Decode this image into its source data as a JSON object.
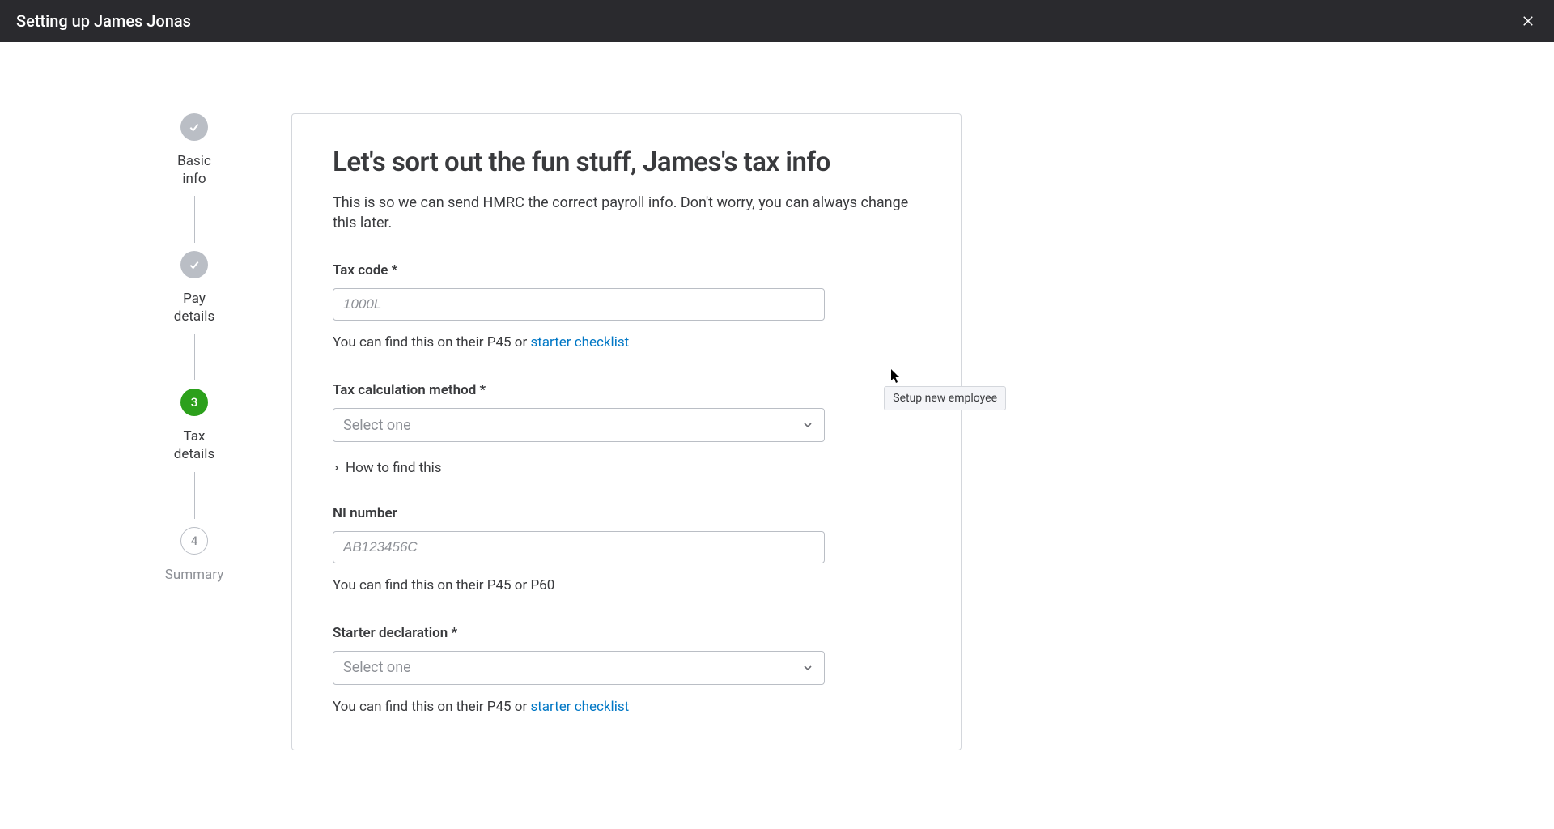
{
  "header": {
    "title": "Setting up James Jonas"
  },
  "stepper": {
    "steps": [
      {
        "label_line1": "Basic",
        "label_line2": "info",
        "state": "completed"
      },
      {
        "label_line1": "Pay",
        "label_line2": "details",
        "state": "completed"
      },
      {
        "number": "3",
        "label_line1": "Tax",
        "label_line2": "details",
        "state": "active"
      },
      {
        "number": "4",
        "label_line1": "Summary",
        "label_line2": "",
        "state": "pending"
      }
    ]
  },
  "panel": {
    "title": "Let's sort out the fun stuff, James's tax info",
    "description": "This is so we can send HMRC the correct payroll info. Don't worry, you can always change this later."
  },
  "form": {
    "tax_code": {
      "label": "Tax code *",
      "placeholder": "1000L",
      "help_prefix": "You can find this on their P45 or ",
      "help_link": "starter checklist"
    },
    "tax_calc_method": {
      "label": "Tax calculation method *",
      "placeholder": "Select one",
      "how_to_find": "How to find this"
    },
    "ni_number": {
      "label": "NI number",
      "placeholder": "AB123456C",
      "help": "You can find this on their P45 or P60"
    },
    "starter_declaration": {
      "label": "Starter declaration *",
      "placeholder": "Select one",
      "help_prefix": "You can find this on their P45 or ",
      "help_link": "starter checklist"
    }
  },
  "tooltip": {
    "text": "Setup new employee"
  }
}
